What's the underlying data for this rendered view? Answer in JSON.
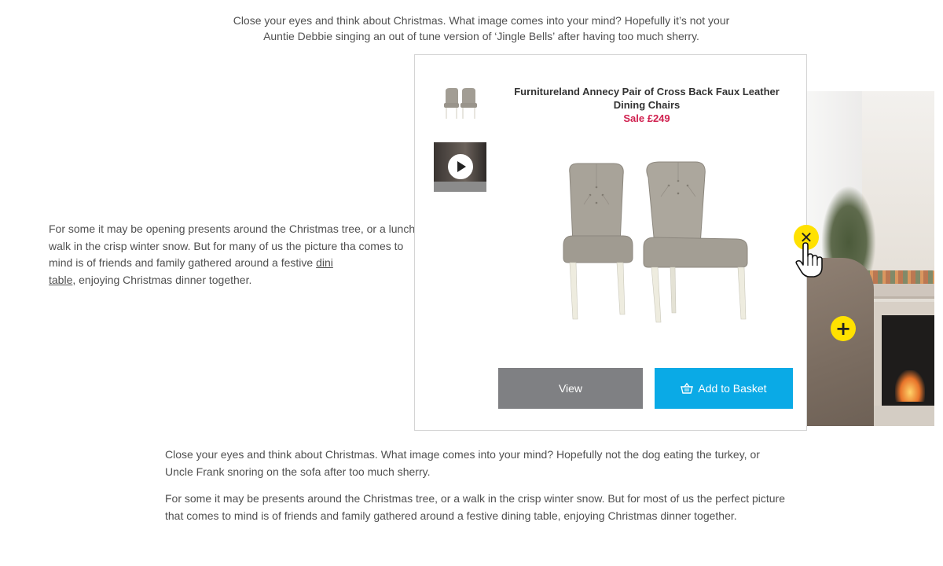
{
  "article": {
    "intro_line1": "Close your eyes and think about Christmas. What image comes into your mind? Hopefully it’s not your",
    "intro_line2": "Auntie Debbie singing an out of tune version of ‘Jingle Bells’ after having too much sherry.",
    "left_para_before_link": "For some it may be opening presents around the Christmas tree, or a lunch walk in the crisp winter snow. But for many of us the picture tha comes to mind is of friends and family gathered around a festive ",
    "left_para_link_part1": "dini",
    "left_para_link_part2": "table",
    "left_para_after_link": ", enjoying Christmas dinner together.",
    "bottom_para1": "Close your eyes and think about Christmas. What image comes into your mind? Hopefully not the dog eating the turkey, or Uncle Frank snoring on the sofa after too much sherry.",
    "bottom_para2": "For some it may be presents around the Christmas tree, or a walk in the crisp winter snow. But for most of us the perfect picture that comes to mind is of friends and family gathered around a festive dining table, enjoying Christmas dinner together."
  },
  "popup": {
    "product_title": "Furnitureland Annecy Pair of Cross Back Faux Leather Dining Chairs",
    "price": "Sale £249",
    "view_label": "View",
    "basket_label": "Add to Basket",
    "basket_icon": "basket-icon",
    "play_icon": "play-icon"
  },
  "hotspots": {
    "close_icon": "close-icon",
    "close_glyph": "✕",
    "plus_icon": "plus-icon",
    "plus_glyph": "+",
    "color": "#ffe100"
  },
  "colors": {
    "price": "#d0204f",
    "view_button": "#7f8083",
    "basket_button": "#0aaae6"
  }
}
